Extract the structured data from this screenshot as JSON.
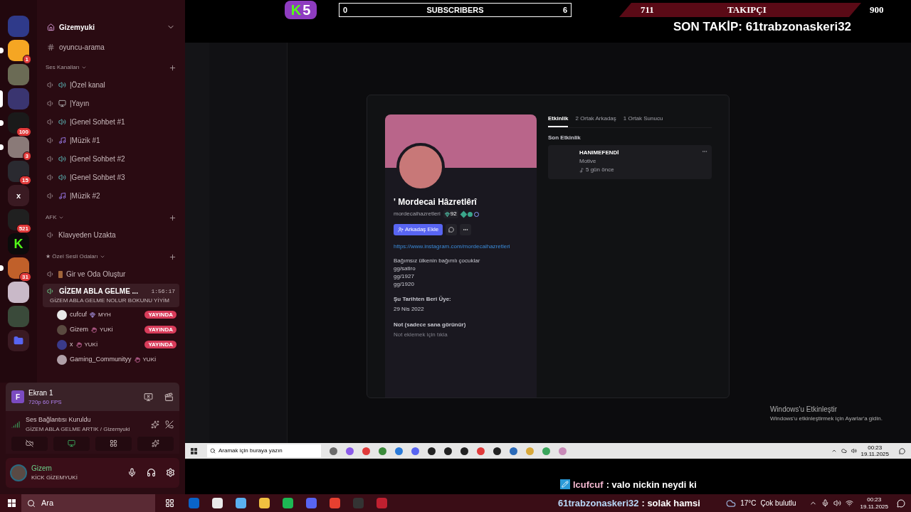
{
  "overlay": {
    "logo_letter": "K",
    "logo_count": "5",
    "subscribers": {
      "start": "0",
      "label": "SUBSCRIBERS",
      "goal": "6",
      "level": 0
    },
    "followers": {
      "start": "711",
      "label": "TAKIPÇI",
      "goal": "900"
    },
    "last_follower": "SON TAKİP: 61trabzonaskeri32"
  },
  "servers": [
    {
      "kind": "image",
      "color": "#2f3a8a",
      "selected": false,
      "unread": false
    },
    {
      "kind": "image",
      "color": "#f5a623",
      "badge": "1",
      "selected": false,
      "unread": true
    },
    {
      "kind": "image",
      "color": "#6b6b55",
      "selected": false,
      "unread": false
    },
    {
      "kind": "image",
      "color": "#3a3570",
      "selected": true,
      "unread": false
    },
    {
      "kind": "image",
      "color": "#1a1a1a",
      "badge": "100",
      "selected": false,
      "unread": true
    },
    {
      "kind": "image",
      "color": "#8a7a78",
      "badge": "3",
      "selected": false,
      "unread": true
    },
    {
      "kind": "image",
      "color": "#2a2a30",
      "badge": "15",
      "selected": false,
      "unread": false
    },
    {
      "kind": "text",
      "label": "x",
      "color": "#3a1a22",
      "selected": false,
      "unread": false
    },
    {
      "kind": "image",
      "color": "#202020",
      "badge": "521",
      "selected": false,
      "unread": false
    },
    {
      "kind": "text",
      "label": "K",
      "color": "#0b0b0b",
      "selected": false,
      "unread": false
    },
    {
      "kind": "image",
      "color": "#c0602a",
      "badge": "31",
      "selected": false,
      "unread": true
    },
    {
      "kind": "image",
      "color": "#c9b9c8",
      "selected": false,
      "unread": false
    },
    {
      "kind": "image",
      "color": "#3a4a3a",
      "selected": false,
      "unread": false
    },
    {
      "kind": "folder",
      "color": "#3a1a22",
      "selected": false,
      "unread": false
    }
  ],
  "server": {
    "name": "Gizemyuki"
  },
  "channels": [
    {
      "kind": "text",
      "name": "oyuncu-arama"
    },
    {
      "kind": "category",
      "name": "Ses Kanalları"
    },
    {
      "kind": "speaker",
      "name": "|Özel kanal"
    },
    {
      "kind": "screen",
      "name": "|Yayın"
    },
    {
      "kind": "speaker",
      "name": "|Genel Sohbet #1"
    },
    {
      "kind": "music",
      "name": "|Müzik #1"
    },
    {
      "kind": "speaker",
      "name": "|Genel Sohbet #2"
    },
    {
      "kind": "speaker",
      "name": "|Genel Sohbet #3"
    },
    {
      "kind": "music",
      "name": "|Müzik #2"
    },
    {
      "kind": "category",
      "name": "AFK"
    },
    {
      "kind": "voice",
      "name": "Klavyeden Uzakta"
    },
    {
      "kind": "category",
      "name": "★ Özel Sesli Odaları"
    },
    {
      "kind": "door",
      "name": "Gir ve Oda Oluştur"
    },
    {
      "kind": "active_voice",
      "name": "GİZEM ABLA GELME ...",
      "duration": "1:56:17",
      "status": "GİZEM ABLA GELME NOLUR BOKUNU YİYİM",
      "members": [
        {
          "name": "cufcuf",
          "kind": "gem",
          "tag": "MYH",
          "live_label": "YAYINDA",
          "color": "#e8e8e8"
        },
        {
          "name": "Gizem",
          "kind": "hand",
          "tag": "YUKİ",
          "live_label": "YAYINDA",
          "color": "#5a4a40"
        },
        {
          "name": "x",
          "kind": "hand",
          "tag": "YUKİ",
          "live_label": "YAYINDA",
          "color": "#3a3a8a"
        },
        {
          "name": "Gaming_Communityy",
          "kind": "hand",
          "tag": "YUKİ",
          "color": "#b0a0a8"
        }
      ]
    }
  ],
  "stream": {
    "avatar_letter": "F",
    "title": "Ekran 1",
    "quality": "720p 60 FPS"
  },
  "voice": {
    "status": "Ses Bağlantısı Kuruldu",
    "channel": "GİZEM ABLA GELME ARTIK / Gizemyuki"
  },
  "user": {
    "name": "Gizem",
    "status": "KİCK GİZEMYUKİ"
  },
  "profile": {
    "name": "' Mordecai Hâzretlêrî",
    "username": "mordecaihazretleri",
    "badge": "92",
    "add_friend": "Arkadaş Ekle",
    "link": "https://www.instagram.com/mordecaihazretleri",
    "bio": [
      "Bağımsız ülkenin bağımlı çocuklar",
      "gg/satiro",
      "gg/1927",
      "gg/1920"
    ],
    "member_since_label": "Şu Tarihten Beri Üye:",
    "member_since": "29 Nis 2022",
    "note_label": "Not (sadece sana görünür)",
    "note_placeholder": "Not eklemek için tıkla"
  },
  "profile_tabs": [
    {
      "label": "Etkinlik",
      "selected": true
    },
    {
      "label": "2 Ortak Arkadaş",
      "selected": false
    },
    {
      "label": "1 Ortak Sunucu",
      "selected": false
    }
  ],
  "recent_activity": {
    "heading": "Son Etkinlik",
    "title": "HANIMEFENDİ",
    "subtitle": "Motive",
    "time": "5 gün önce"
  },
  "inner_taskbar": {
    "search": "Aramak için buraya yazın",
    "time": "00:23",
    "date": "19.11.2025"
  },
  "activation": {
    "title": "Windows'u Etkinleştir",
    "text": "Windows'u etkinleştirmek için Ayarlar'a gidin."
  },
  "chat": [
    {
      "user": "lcufcuf",
      "text": ": valo nickin neydi ki",
      "color": "#f4b8d0",
      "badge": true
    },
    {
      "user": "61trabzonaskeri32",
      "text": ": solak hamsi",
      "color": "#b8d8f8",
      "badge": false
    }
  ],
  "taskbar": {
    "search": "Ara",
    "temperature": "17°C",
    "weather": "Çok bulutlu",
    "time": "00:23",
    "date": "19.11.2025"
  }
}
